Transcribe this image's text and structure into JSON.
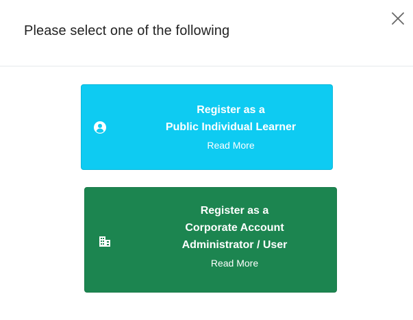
{
  "modal": {
    "title": "Please select one of the following",
    "close_icon": "close-icon"
  },
  "options": [
    {
      "icon": "user-circle-icon",
      "lines": [
        "Register as a",
        "Public Individual Learner"
      ],
      "read_more": "Read More",
      "color": "#0ecbf2"
    },
    {
      "icon": "building-icon",
      "lines": [
        "Register as a",
        "Corporate Account",
        "Administrator / User"
      ],
      "read_more": "Read More",
      "color": "#1c8550"
    }
  ]
}
